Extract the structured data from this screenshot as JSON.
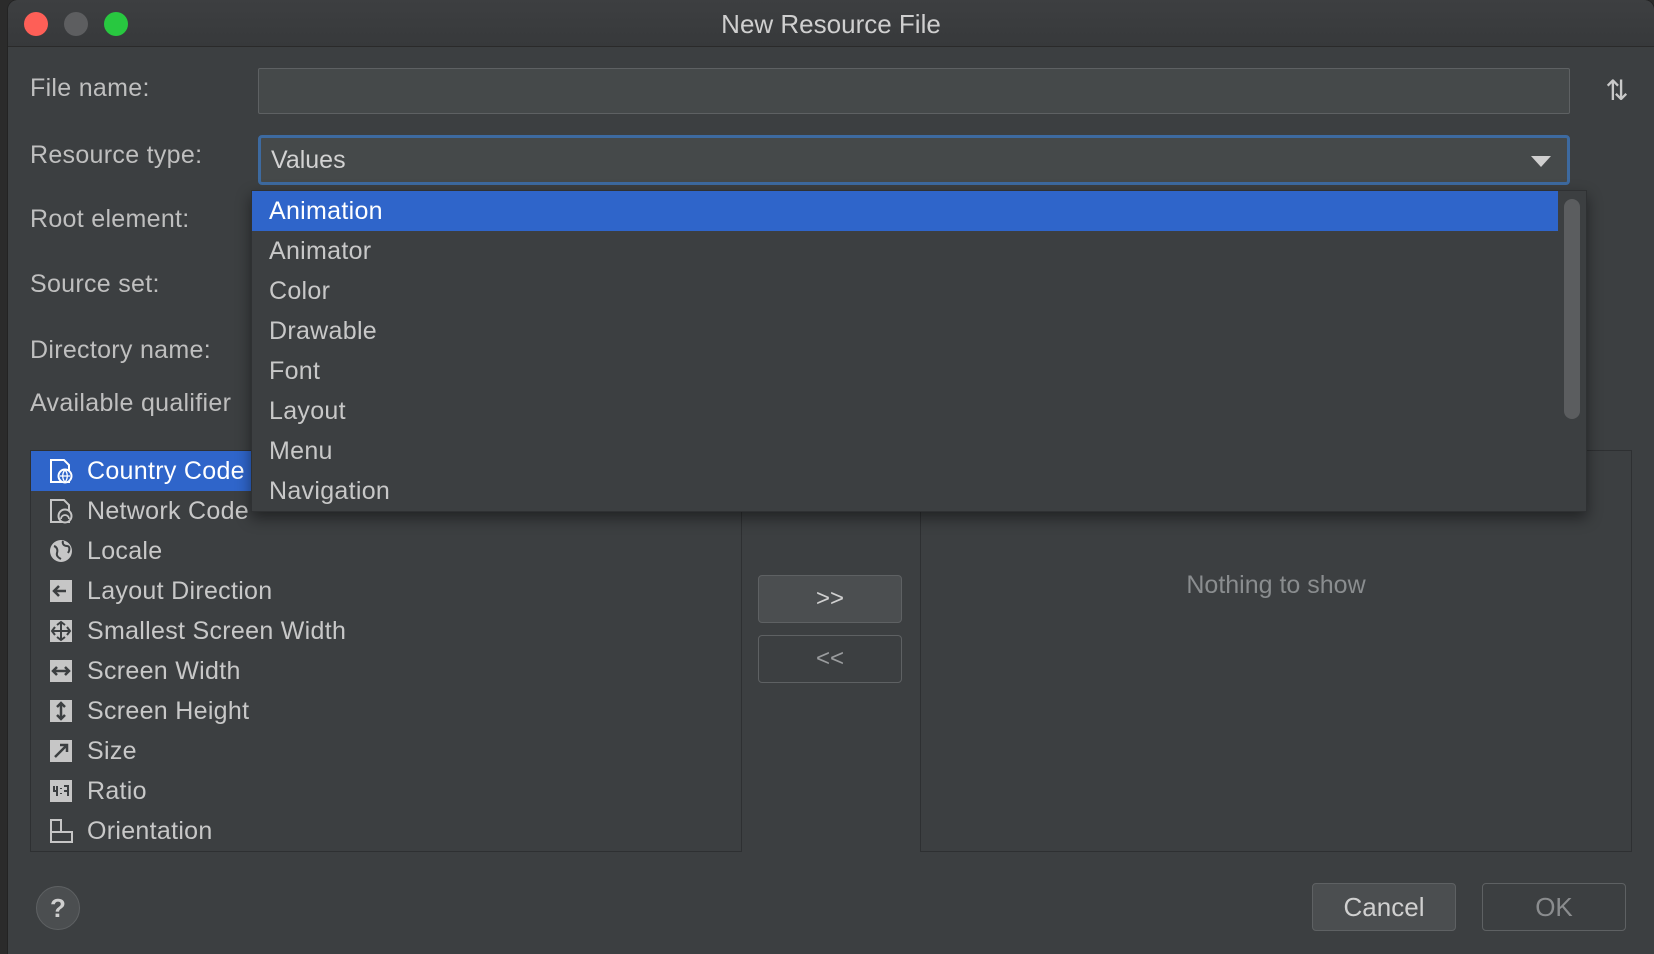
{
  "window": {
    "title": "New Resource File"
  },
  "form": {
    "file_name_label": "File name:",
    "file_name_value": "",
    "resource_type_label": "Resource type:",
    "resource_type_value": "Values",
    "root_element_label": "Root element:",
    "source_set_label": "Source set:",
    "directory_name_label": "Directory name:",
    "available_qualifiers_label": "Available qualifier"
  },
  "dropdown": {
    "selected_index": 0,
    "items": [
      "Animation",
      "Animator",
      "Color",
      "Drawable",
      "Font",
      "Layout",
      "Menu",
      "Navigation"
    ]
  },
  "qualifiers": {
    "selected_index": 0,
    "items": [
      {
        "label": "Country Code",
        "icon": "country-code-icon"
      },
      {
        "label": "Network Code",
        "icon": "network-code-icon"
      },
      {
        "label": "Locale",
        "icon": "globe-icon"
      },
      {
        "label": "Layout Direction",
        "icon": "layout-direction-icon"
      },
      {
        "label": "Smallest Screen Width",
        "icon": "smallest-screen-width-icon"
      },
      {
        "label": "Screen Width",
        "icon": "screen-width-icon"
      },
      {
        "label": "Screen Height",
        "icon": "screen-height-icon"
      },
      {
        "label": "Size",
        "icon": "size-icon"
      },
      {
        "label": "Ratio",
        "icon": "ratio-icon"
      },
      {
        "label": "Orientation",
        "icon": "orientation-icon"
      }
    ]
  },
  "chosen": {
    "empty_text": "Nothing to show"
  },
  "buttons": {
    "add": ">>",
    "remove": "<<",
    "cancel": "Cancel",
    "ok": "OK",
    "help": "?"
  },
  "colors": {
    "selection": "#2f65ca",
    "background": "#3c3f41",
    "focus_border": "#3d6aa0"
  }
}
